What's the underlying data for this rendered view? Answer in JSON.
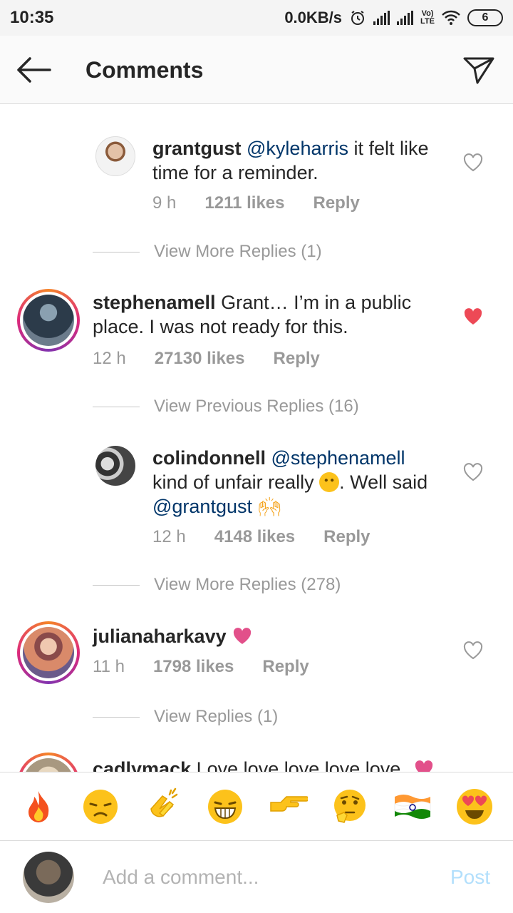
{
  "status_bar": {
    "time": "10:35",
    "net_speed": "0.0KB/s",
    "volte": "Vo)\nLTE",
    "battery": "6"
  },
  "header": {
    "title": "Comments",
    "back_icon": "arrow-left-icon",
    "send_icon": "paper-plane-icon"
  },
  "comments": [
    {
      "username": "grantgust",
      "mention": "@kyleharris",
      "text": " it felt like time for a reminder.",
      "time": "9 h",
      "likes": "1211 likes",
      "reply": "Reply",
      "liked": false
    },
    {
      "view_more": "View More Replies (1)"
    },
    {
      "username": "stephenamell",
      "text": "Grant… I’m in a public place. I was not ready for this.",
      "time": "12 h",
      "likes": "27130 likes",
      "reply": "Reply",
      "liked": true
    },
    {
      "view_more": "View Previous Replies (16)"
    },
    {
      "username": "colindonnell",
      "mention": "@stephenamell",
      "text_line2": "kind of unfair really",
      "text_after_emoji": ". Well said",
      "mention2": "@grantgust",
      "time": "12 h",
      "likes": "4148 likes",
      "reply": "Reply",
      "liked": false
    },
    {
      "view_more": "View More Replies (278)"
    },
    {
      "username": "julianaharkavy",
      "time": "11 h",
      "likes": "1798 likes",
      "reply": "Reply",
      "liked": false
    },
    {
      "view_more": "View Replies (1)"
    },
    {
      "username": "cadlymack",
      "text": "Love love love love love"
    }
  ],
  "emoji_bar": [
    "fire-icon",
    "sad-face-icon",
    "clapping-hands-icon",
    "laughing-face-icon",
    "pointing-hand-icon",
    "thinking-face-icon",
    "india-flag-icon",
    "heart-eyes-icon"
  ],
  "input": {
    "placeholder": "Add a comment...",
    "post_label": "Post"
  },
  "colors": {
    "mention": "#003569",
    "liked_heart": "#ed4956",
    "meta": "#999999",
    "post_disabled": "#b2dffc"
  }
}
